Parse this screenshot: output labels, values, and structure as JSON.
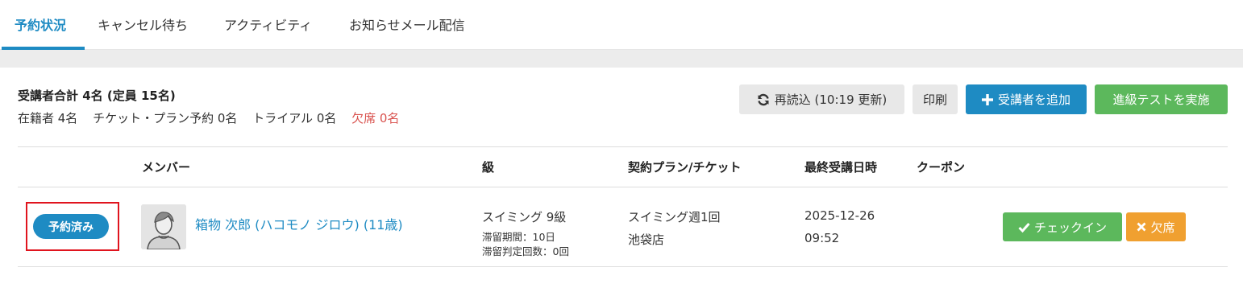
{
  "tabs": [
    {
      "label": "予約状況"
    },
    {
      "label": "キャンセル待ち"
    },
    {
      "label": "アクティビティ"
    },
    {
      "label": "お知らせメール配信"
    }
  ],
  "summary": {
    "title": "受講者合計 4名 (定員 15名)",
    "enrolled": "在籍者 4名",
    "ticket_plan": "チケット・プラン予約 0名",
    "trial": "トライアル 0名",
    "absent": "欠席 0名"
  },
  "toolbar": {
    "reload_label": "再読込 (10:19 更新)",
    "print_label": "印刷",
    "add_label": "受講者を追加",
    "test_label": "進級テストを実施"
  },
  "table": {
    "headers": {
      "member": "メンバー",
      "grade": "級",
      "plan": "契約プラン/チケット",
      "last_date": "最終受講日時",
      "coupon": "クーポン"
    },
    "rows": [
      {
        "status": "予約済み",
        "name": "箱物 次郎 (ハコモノ ジロウ) (11歳)",
        "grade": "スイミング 9級",
        "stay_period": "滞留期間：10日",
        "stay_count": "滞留判定回数：0回",
        "plan": "スイミング週1回",
        "store": "池袋店",
        "last_date": "2025-12-26",
        "last_time": "09:52",
        "checkin_label": "チェックイン",
        "absent_label": "欠席"
      }
    ]
  },
  "colors": {
    "accent": "#1e8bc3",
    "success": "#5cb85c",
    "warning": "#f0a030",
    "danger": "#d9534f",
    "highlight": "#e0141e"
  }
}
